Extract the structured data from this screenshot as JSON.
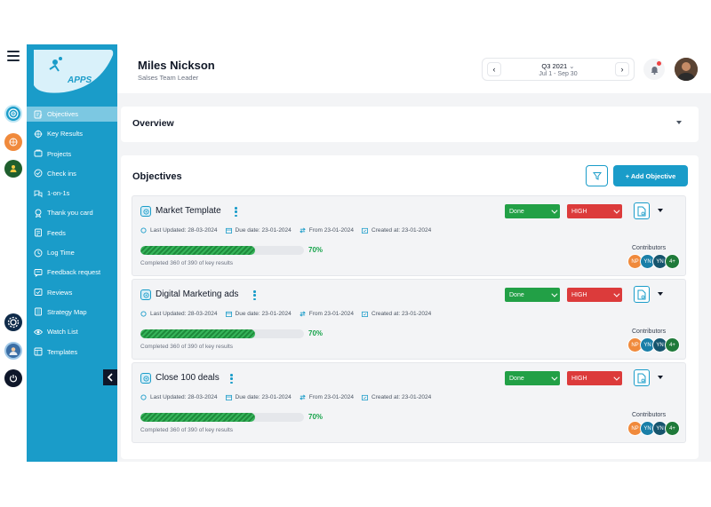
{
  "rail": {
    "icons": [
      "objectives-icon",
      "orange-app-icon",
      "green-app-icon",
      "settings-icon",
      "user-avatar-icon",
      "power-icon"
    ]
  },
  "sidebar": {
    "logo_text": "APPS",
    "items": [
      {
        "label": "Objectives",
        "icon": "objectives-icon",
        "active": true
      },
      {
        "label": "Key Results",
        "icon": "key-results-icon",
        "active": false
      },
      {
        "label": "Projects",
        "icon": "projects-icon",
        "active": false
      },
      {
        "label": "Check ins",
        "icon": "check-ins-icon",
        "active": false
      },
      {
        "label": "1-on-1s",
        "icon": "one-on-one-icon",
        "active": false
      },
      {
        "label": "Thank you card",
        "icon": "thank-you-icon",
        "active": false
      },
      {
        "label": "Feeds",
        "icon": "feeds-icon",
        "active": false
      },
      {
        "label": "Log Time",
        "icon": "log-time-icon",
        "active": false
      },
      {
        "label": "Feedback request",
        "icon": "feedback-icon",
        "active": false
      },
      {
        "label": "Reviews",
        "icon": "reviews-icon",
        "active": false
      },
      {
        "label": "Strategy Map",
        "icon": "strategy-map-icon",
        "active": false
      },
      {
        "label": "Watch List",
        "icon": "watch-list-icon",
        "active": false
      },
      {
        "label": "Templates",
        "icon": "templates-icon",
        "active": false
      }
    ]
  },
  "header": {
    "user_name": "Miles Nickson",
    "user_role": "Salses Team Leader",
    "quarter": "Q3 2021",
    "date_range": "Jul 1 - Sep 30"
  },
  "overview": {
    "title": "Overview"
  },
  "objectives": {
    "title": "Objectives",
    "add_label": "+ Add Objective",
    "contributors_label": "Contributors",
    "items": [
      {
        "title": "Market Template",
        "last_updated": "Last Updated: 28-03-2024",
        "due_date": "Due date: 23-01-2024",
        "from": "From 23-01-2024",
        "created": "Created at: 23-01-2024",
        "progress": 70,
        "progress_label": "70%",
        "completed_text": "Completed 360 of 390 of key results",
        "status": "Done",
        "priority": "HIGH",
        "contributors": [
          {
            "initials": "NP",
            "color": "#f08a3c"
          },
          {
            "initials": "YN",
            "color": "#1a7fa8"
          },
          {
            "initials": "YN",
            "color": "#16556e"
          },
          {
            "initials": "4+",
            "color": "#1f7a3a"
          }
        ]
      },
      {
        "title": "Digital Marketing ads",
        "last_updated": "Last Updated: 28-03-2024",
        "due_date": "Due date: 23-01-2024",
        "from": "From 23-01-2024",
        "created": "Created at: 23-01-2024",
        "progress": 70,
        "progress_label": "70%",
        "completed_text": "Completed 360 of 390 of key results",
        "status": "Done",
        "priority": "HIGH",
        "contributors": [
          {
            "initials": "NP",
            "color": "#f08a3c"
          },
          {
            "initials": "YN",
            "color": "#1a7fa8"
          },
          {
            "initials": "YN",
            "color": "#16556e"
          },
          {
            "initials": "4+",
            "color": "#1f7a3a"
          }
        ]
      },
      {
        "title": "Close 100 deals",
        "last_updated": "Last Updated: 28-03-2024",
        "due_date": "Due date: 23-01-2024",
        "from": "From 23-01-2024",
        "created": "Created at: 23-01-2024",
        "progress": 70,
        "progress_label": "70%",
        "completed_text": "Completed 360 of 390 of key results",
        "status": "Done",
        "priority": "HIGH",
        "contributors": [
          {
            "initials": "NP",
            "color": "#f08a3c"
          },
          {
            "initials": "YN",
            "color": "#1a7fa8"
          },
          {
            "initials": "YN",
            "color": "#16556e"
          },
          {
            "initials": "4+",
            "color": "#1f7a3a"
          }
        ]
      }
    ]
  },
  "colors": {
    "brand": "#1a9cc9",
    "done": "#22a046",
    "high": "#dc3b3b",
    "progress": "#16a34a"
  }
}
